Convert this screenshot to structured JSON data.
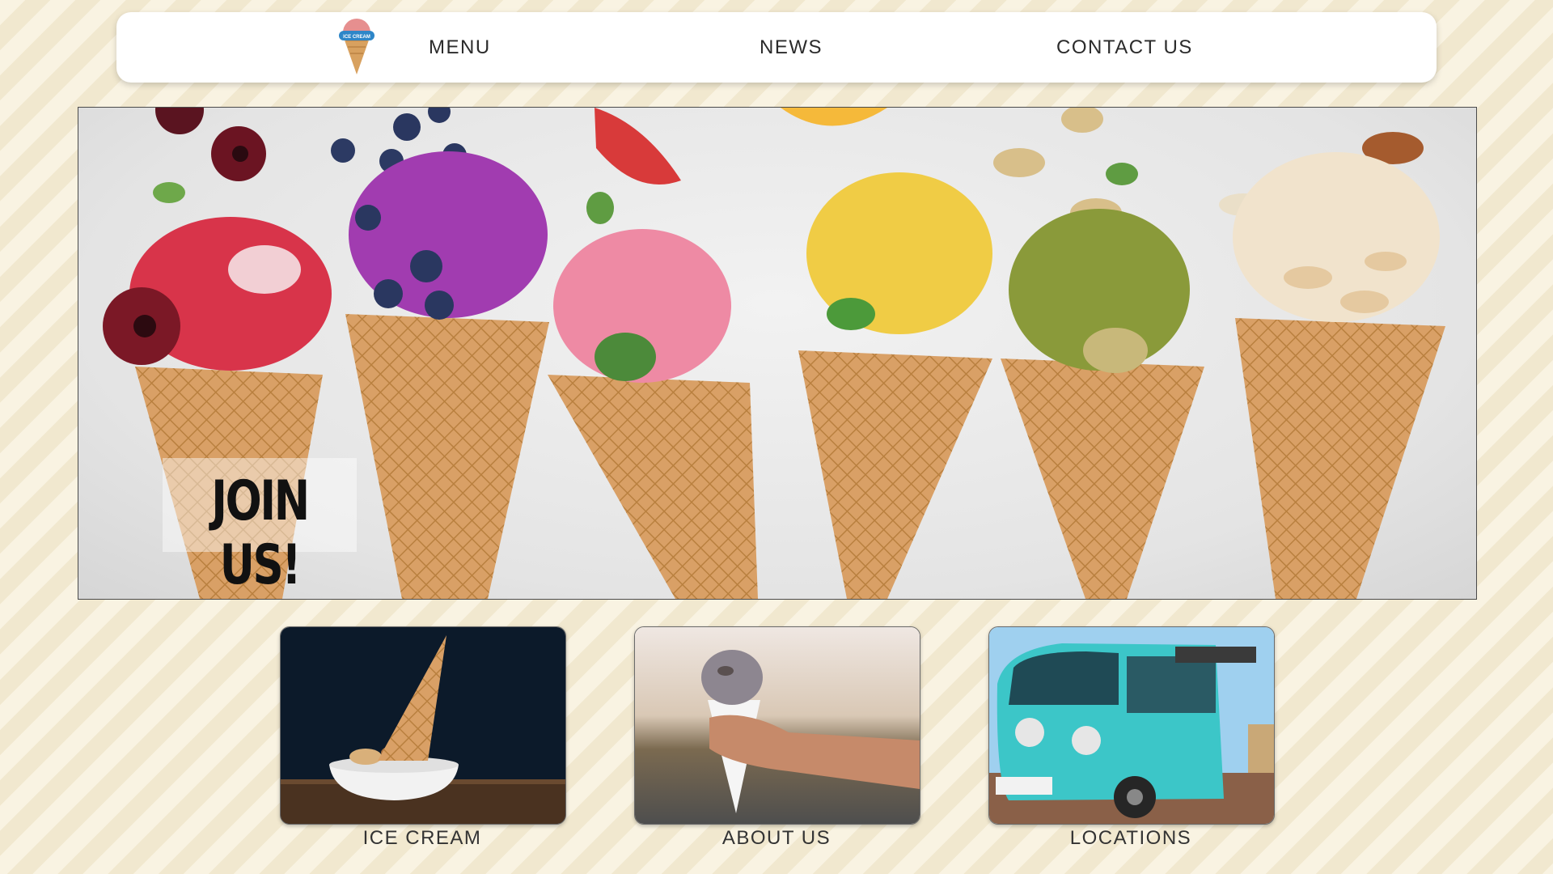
{
  "nav": {
    "logo_text": "ICE CREAM",
    "links": [
      {
        "label": "MENU"
      },
      {
        "label": "NEWS"
      },
      {
        "label": "CONTACT US"
      }
    ]
  },
  "hero": {
    "cta_label": "JOIN US!",
    "flavors": [
      "red berry",
      "blueberry",
      "strawberry",
      "lemon",
      "pistachio",
      "almond"
    ]
  },
  "cards": [
    {
      "label": "ICE CREAM"
    },
    {
      "label": "ABOUT US"
    },
    {
      "label": "LOCATIONS"
    }
  ],
  "colors": {
    "background": "#f7f0dc",
    "nav_bg": "#ffffff",
    "text": "#2b2b2b",
    "cone": "#d9a066",
    "bus": "#3cc6c8"
  }
}
